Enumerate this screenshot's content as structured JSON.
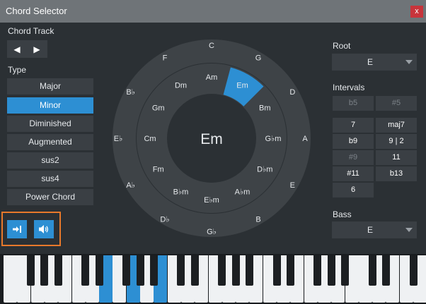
{
  "window": {
    "title": "Chord Selector",
    "close_label": "x"
  },
  "chord_track": {
    "label": "Chord Track"
  },
  "type": {
    "label": "Type",
    "options": [
      "Major",
      "Minor",
      "Diminished",
      "Augmented",
      "sus2",
      "sus4",
      "Power Chord"
    ],
    "selected": "Minor"
  },
  "wheel": {
    "center_label": "Em",
    "major": [
      "C",
      "G",
      "D",
      "A",
      "E",
      "B",
      "G♭",
      "D♭",
      "A♭",
      "E♭",
      "B♭",
      "F"
    ],
    "minor": [
      "Am",
      "Em",
      "Bm",
      "G♭m",
      "D♭m",
      "A♭m",
      "E♭m",
      "B♭m",
      "Fm",
      "Cm",
      "Gm",
      "Dm"
    ],
    "selected_minor": "Em",
    "highlight_color": "#2d8fd3"
  },
  "root": {
    "label": "Root",
    "value": "E"
  },
  "intervals": {
    "label": "Intervals",
    "buttons": [
      {
        "label": "b5",
        "enabled": false
      },
      {
        "label": "#5",
        "enabled": false
      },
      {
        "label": "7",
        "enabled": true
      },
      {
        "label": "maj7",
        "enabled": true
      },
      {
        "label": "b9",
        "enabled": true
      },
      {
        "label": "9 | 2",
        "enabled": true
      },
      {
        "label": "#9",
        "enabled": false
      },
      {
        "label": "11",
        "enabled": true
      },
      {
        "label": "#11",
        "enabled": true
      },
      {
        "label": "b13",
        "enabled": true
      },
      {
        "label": "6",
        "enabled": true
      }
    ]
  },
  "bass": {
    "label": "Bass",
    "value": "E"
  },
  "icons": {
    "prev": "arrow-left-icon",
    "next": "arrow-right-icon",
    "insert": "insert-chord-icon",
    "listen": "speaker-icon"
  },
  "keyboard": {
    "highlighted_notes": [
      "E",
      "G",
      "B"
    ]
  }
}
